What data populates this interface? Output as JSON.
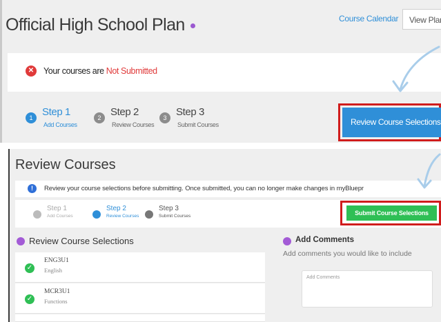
{
  "top": {
    "title": "Official High School Plan",
    "course_calendar_link": "Course Calendar",
    "view_plan_button": "View Plan",
    "notice": {
      "prefix": "Your courses are ",
      "status": "Not Submitted"
    },
    "steps": [
      {
        "number": "1",
        "name": "Step 1",
        "sub": "Add Courses",
        "active": true
      },
      {
        "number": "2",
        "name": "Step 2",
        "sub": "Review Courses",
        "active": false
      },
      {
        "number": "3",
        "name": "Step 3",
        "sub": "Submit Courses",
        "active": false
      }
    ],
    "review_button": "Review Course Selections"
  },
  "bottom": {
    "title": "Review Courses",
    "info_text": "Review your course selections before submitting. Once submitted, you can no longer make changes in myBluepr",
    "steps": [
      {
        "name": "Step 1",
        "sub": "Add Courses",
        "state": "done"
      },
      {
        "name": "Step 2",
        "sub": "Review Courses",
        "state": "active"
      },
      {
        "name": "Step 3",
        "sub": "Submit Courses",
        "state": "pending"
      }
    ],
    "submit_button": "Submit Course Selections",
    "review_selections_heading": "Review Course Selections",
    "courses": [
      {
        "code": "ENG3U1",
        "name": "English"
      },
      {
        "code": "MCR3U1",
        "name": "Functions"
      }
    ],
    "add_comments_heading": "Add Comments",
    "add_comments_sub": "Add comments you would like to include",
    "comments_placeholder": "Add Comments"
  },
  "colors": {
    "accent_blue": "#2f8fd8",
    "alert_red": "#e03a3a",
    "highlight_red": "#d01c1c",
    "submit_green": "#2fbf55",
    "purple": "#a35bd6",
    "arrow_blue": "#a9cdea"
  }
}
